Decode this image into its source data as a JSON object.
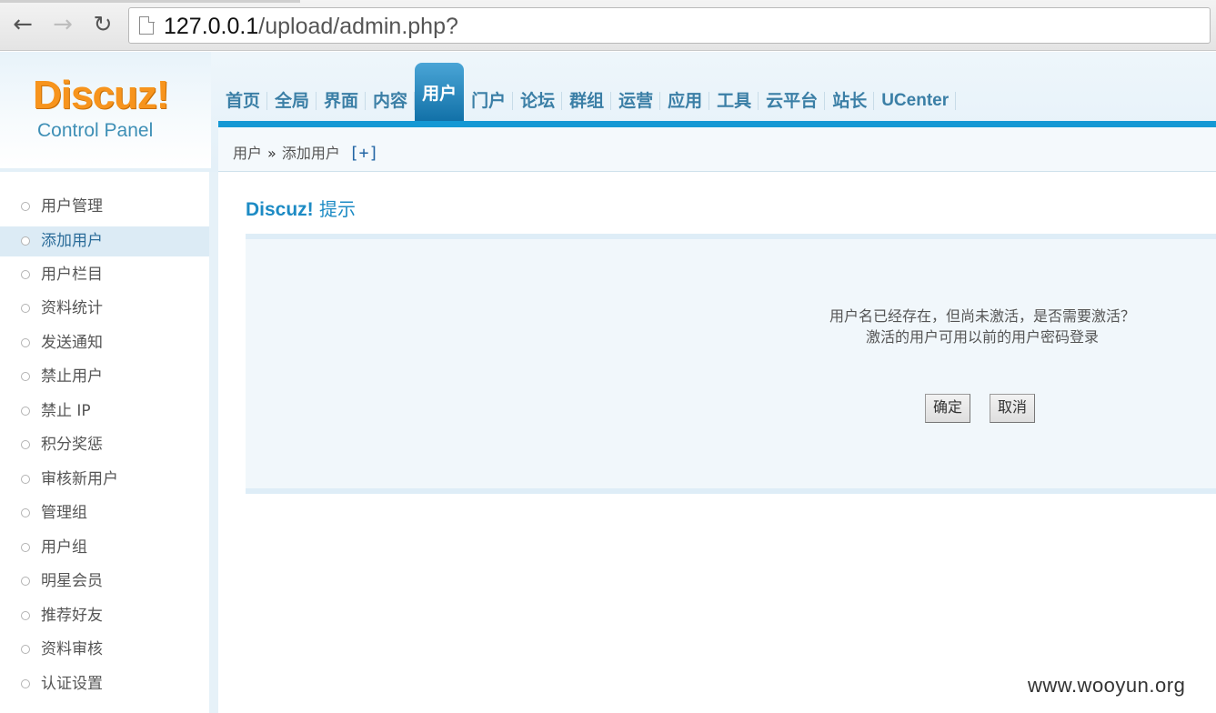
{
  "browser": {
    "url_host": "127.0.0.1",
    "url_path": "/upload/admin.php?"
  },
  "header": {
    "logo_text": "Discuz!",
    "logo_sub": "Control Panel",
    "nav": [
      {
        "label": "首页"
      },
      {
        "label": "全局"
      },
      {
        "label": "界面"
      },
      {
        "label": "内容"
      },
      {
        "label": "用户",
        "active": true
      },
      {
        "label": "门户"
      },
      {
        "label": "论坛"
      },
      {
        "label": "群组"
      },
      {
        "label": "运营"
      },
      {
        "label": "应用"
      },
      {
        "label": "工具"
      },
      {
        "label": "云平台"
      },
      {
        "label": "站长"
      },
      {
        "label": "UCenter"
      }
    ]
  },
  "breadcrumb": {
    "parent": "用户",
    "separator": "»",
    "current": "添加用户",
    "add": "[+]"
  },
  "sidebar": {
    "items": [
      {
        "label": "用户管理"
      },
      {
        "label": "添加用户",
        "active": true
      },
      {
        "label": "用户栏目"
      },
      {
        "label": "资料统计"
      },
      {
        "label": "发送通知"
      },
      {
        "label": "禁止用户"
      },
      {
        "label": "禁止 IP"
      },
      {
        "label": "积分奖惩"
      },
      {
        "label": "审核新用户"
      },
      {
        "label": "管理组"
      },
      {
        "label": "用户组"
      },
      {
        "label": "明星会员"
      },
      {
        "label": "推荐好友"
      },
      {
        "label": "资料审核"
      },
      {
        "label": "认证设置"
      }
    ]
  },
  "main": {
    "title_brand": "Discuz!",
    "title_text": "提示",
    "message_line1": "用户名已经存在，但尚未激活，是否需要激活？",
    "message_line2": "激活的用户可用以前的用户密码登录",
    "confirm_label": "确定",
    "cancel_label": "取消"
  },
  "watermark": "www.wooyun.org",
  "colors": {
    "accent": "#1498d4",
    "logo_orange": "#f7941d",
    "nav_text": "#3b7fa6"
  }
}
